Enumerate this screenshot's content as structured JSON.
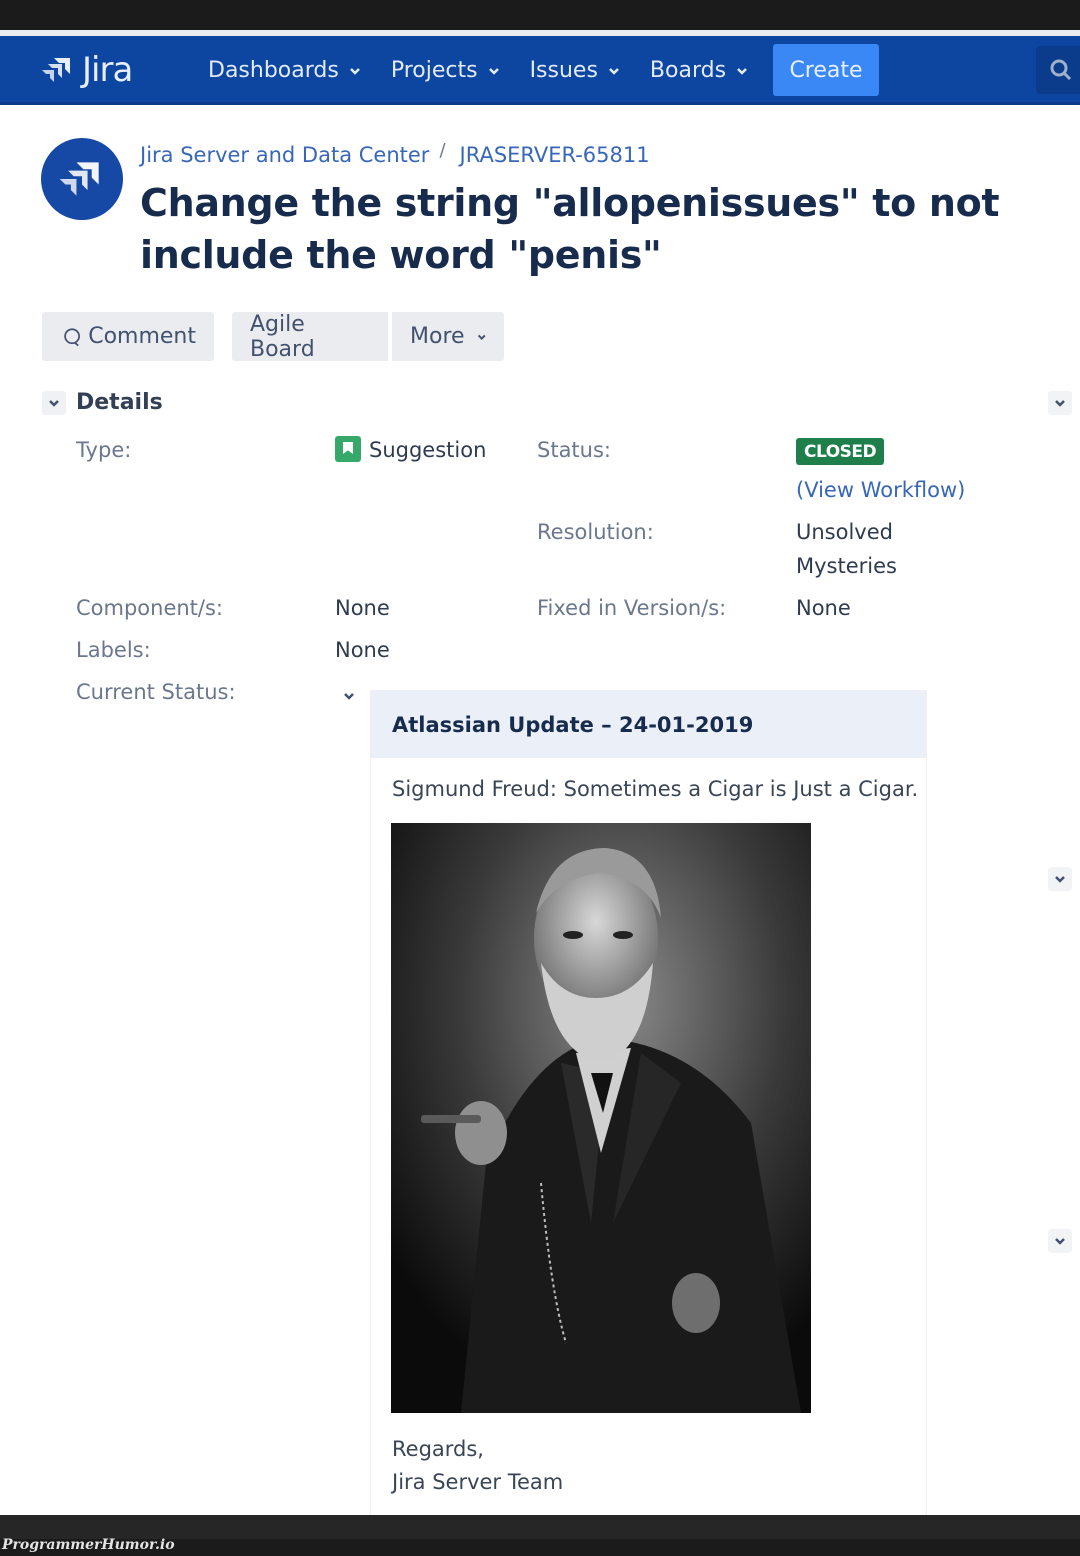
{
  "navbar": {
    "logo_text": "Jira",
    "items": [
      {
        "label": "Dashboards"
      },
      {
        "label": "Projects"
      },
      {
        "label": "Issues"
      },
      {
        "label": "Boards"
      }
    ],
    "create_label": "Create",
    "search_icon": "search-icon",
    "accent_color": "#0c46a0",
    "create_color": "#3a88f5"
  },
  "issue": {
    "breadcrumb": {
      "project": "Jira Server and Data Center",
      "separator": "/",
      "key": "JRASERVER-65811"
    },
    "title": "Change the string \"allopenissues\" to not include the word \"penis\""
  },
  "toolbar": {
    "comment_label": "Comment",
    "agile_board_label": "Agile Board",
    "more_label": "More"
  },
  "details": {
    "heading": "Details",
    "type": {
      "label": "Type:",
      "value": "Suggestion"
    },
    "status": {
      "label": "Status:",
      "value": "CLOSED",
      "workflow_link": "(View Workflow)",
      "badge_color": "#1f7f4b"
    },
    "resolution": {
      "label": "Resolution:",
      "value_line1": "Unsolved",
      "value_line2": "Mysteries"
    },
    "components": {
      "label": "Component/s:",
      "value": "None"
    },
    "fix_versions": {
      "label": "Fixed in Version/s:",
      "value": "None"
    },
    "labels": {
      "label": "Labels:",
      "value": "None"
    },
    "current_status": {
      "label": "Current Status:"
    }
  },
  "update_panel": {
    "heading": "Atlassian Update – 24-01-2019",
    "quote": "Sigmund Freud: Sometimes a Cigar is Just a Cigar.",
    "image_alt": "Black and white portrait of Sigmund Freud holding a cigar",
    "regards": "Regards,",
    "signature": "Jira Server Team"
  },
  "watermark": "ProgrammerHumor.io"
}
